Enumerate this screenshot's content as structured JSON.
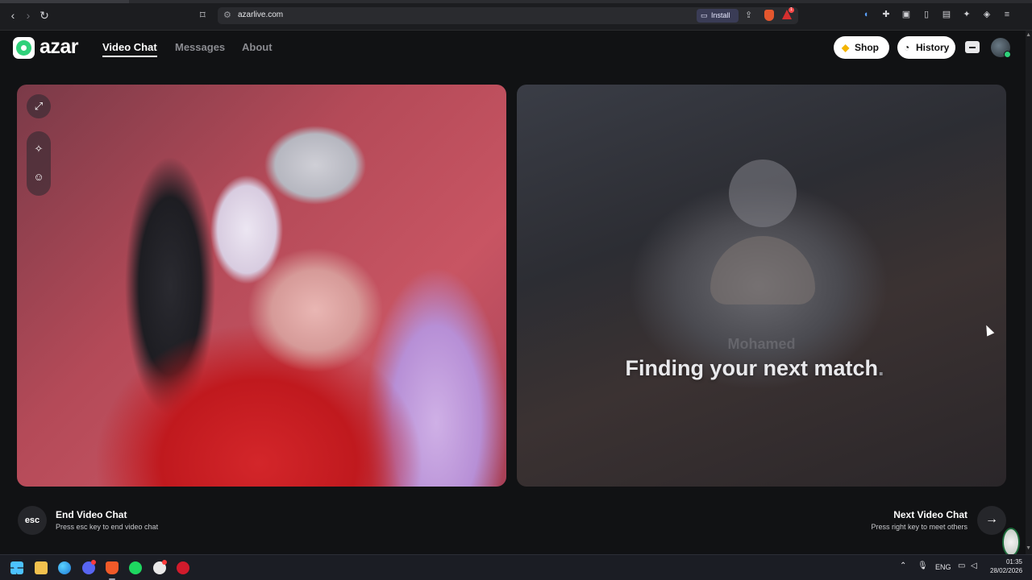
{
  "browser": {
    "url": "azarlive.com",
    "install_label": "Install",
    "alert_count": "1"
  },
  "site": {
    "logo_text": "azar",
    "nav": [
      {
        "label": "Video Chat",
        "active": true
      },
      {
        "label": "Messages",
        "active": false
      },
      {
        "label": "About",
        "active": false
      }
    ],
    "shop_label": "Shop",
    "history_label": "History"
  },
  "video": {
    "remote_name_ghost": "Mohamed",
    "finding_text": "Finding your next match",
    "finding_dot": ".",
    "controls": [
      "expand-icon",
      "magic-wand-icon",
      "face-icon"
    ]
  },
  "footer": {
    "esc_key": "esc",
    "end_title": "End Video Chat",
    "end_sub": "Press esc key to end video chat",
    "next_title": "Next Video Chat",
    "next_sub": "Press right key to meet others",
    "next_arrow": "→"
  },
  "taskbar": {
    "lang": "ENG",
    "time": "01:35",
    "date": "28/02/2026"
  },
  "colors": {
    "brand_green": "#2fd17a",
    "background": "#111214",
    "shop_gem": "#f4b400"
  }
}
